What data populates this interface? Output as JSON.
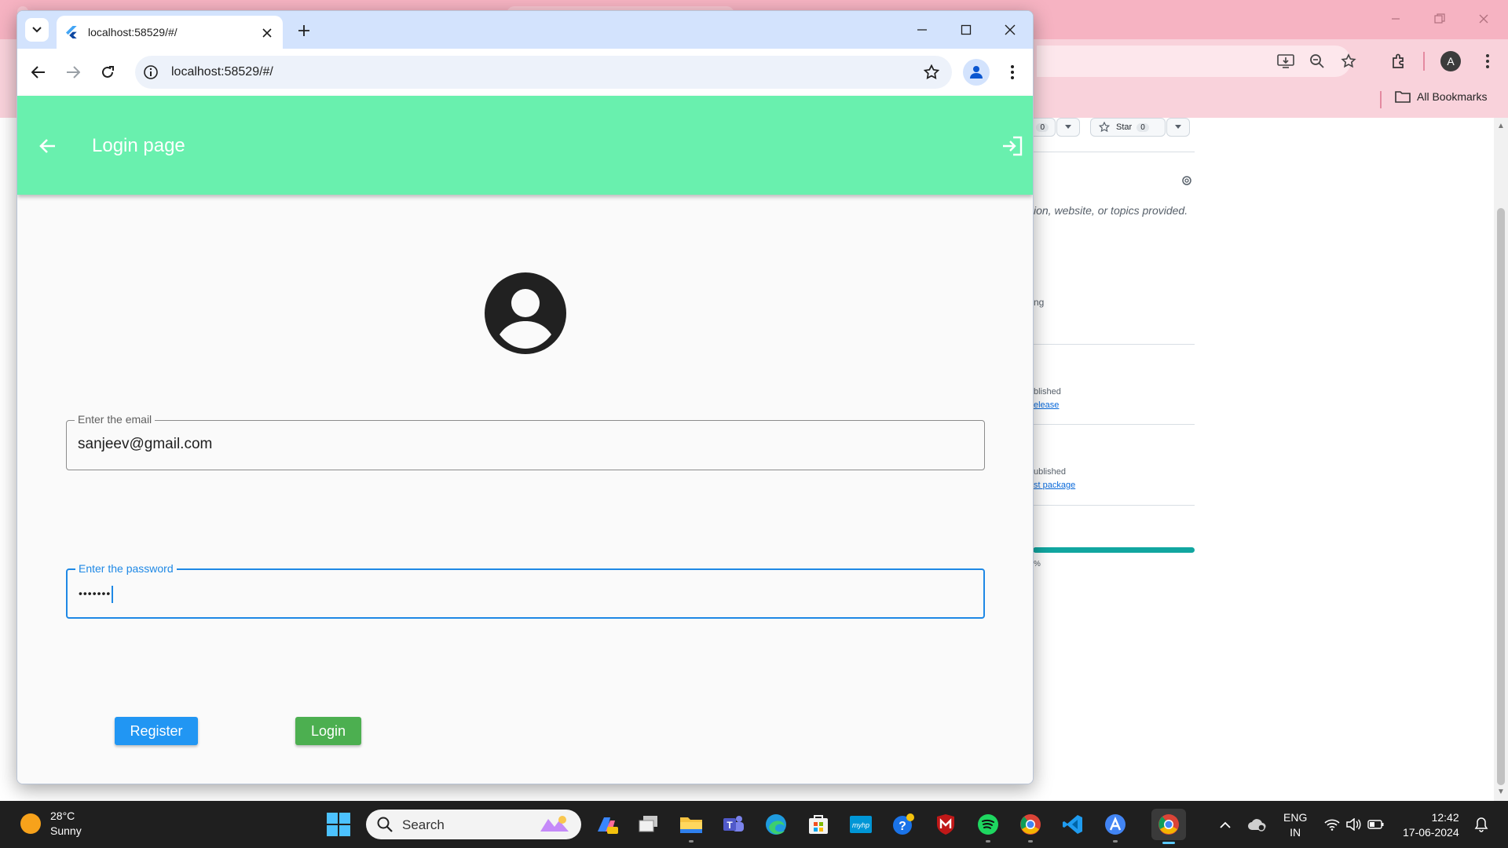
{
  "background_page": {
    "bookmarks_label": "All Bookmarks",
    "avatar_letter": "A",
    "star_label": "Star",
    "star_count": "0",
    "watch_count": "0",
    "about_text": "ion, website, or topics provided.",
    "row1_text": "ng",
    "release_status": "blished",
    "release_link": "elease",
    "package_status": "ublished",
    "package_link": "st package",
    "language_percent": "%"
  },
  "browser": {
    "tab_title": "localhost:58529/#/",
    "url": "localhost:58529/#/"
  },
  "app": {
    "title": "Login page",
    "email_label": "Enter the email",
    "email_value": "sanjeev@gmail.com",
    "password_label": "Enter the password",
    "password_value": "•••••••",
    "register_label": "Register",
    "login_label": "Login",
    "appbar_color": "#69f0ae",
    "register_color": "#2196f3",
    "login_color": "#4caf50"
  },
  "taskbar": {
    "temperature": "28°C",
    "weather": "Sunny",
    "search_placeholder": "Search",
    "lang_line1": "ENG",
    "lang_line2": "IN",
    "time": "12:42",
    "date": "17-06-2024",
    "apps": [
      "copilot-icon",
      "task-view-icon",
      "file-explorer-icon",
      "teams-icon",
      "edge-icon",
      "store-icon",
      "myhp-icon",
      "help-icon",
      "mcafee-icon",
      "spotify-icon",
      "chrome-icon",
      "vscode-icon",
      "android-studio-icon",
      "chrome-icon"
    ]
  }
}
